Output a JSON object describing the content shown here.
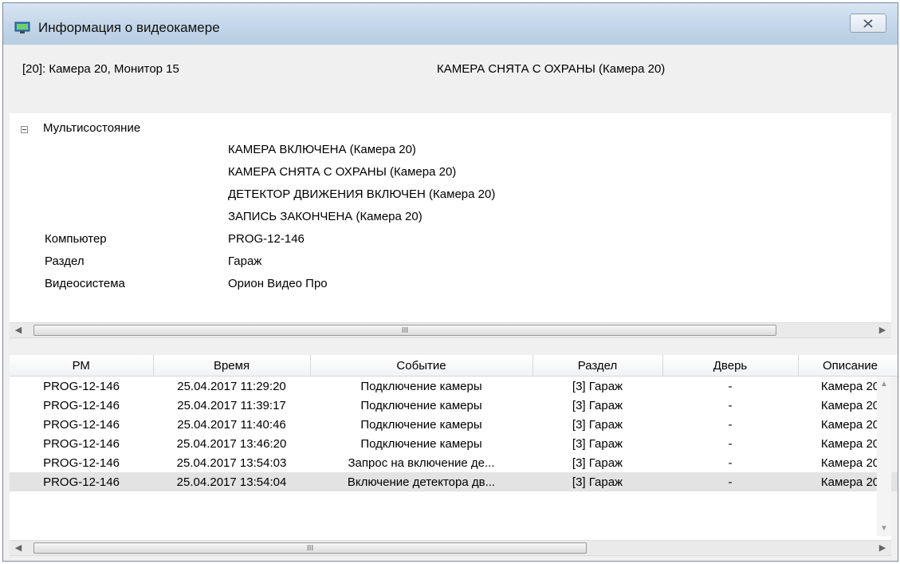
{
  "window": {
    "title": "Информация о видеокамере"
  },
  "info": {
    "camera": "[20]: Камера 20, Монитор 15",
    "state": "КАМЕРА СНЯТА С ОХРАНЫ (Камера 20)"
  },
  "props": {
    "group_label": "Мультисостояние",
    "multistate": [
      "КАМЕРА ВКЛЮЧЕНА (Камера 20)",
      "КАМЕРА СНЯТА С ОХРАНЫ (Камера 20)",
      "ДЕТЕКТОР ДВИЖЕНИЯ ВКЛЮЧЕН (Камера 20)",
      "ЗАПИСЬ ЗАКОНЧЕНА (Камера 20)"
    ],
    "rows": [
      {
        "name": "Компьютер",
        "value": "PROG-12-146"
      },
      {
        "name": "Раздел",
        "value": "Гараж"
      },
      {
        "name": "Видеосистема",
        "value": "Орион Видео Про"
      }
    ]
  },
  "scroll_glyph": "III",
  "events": {
    "columns": [
      "РМ",
      "Время",
      "Событие",
      "Раздел",
      "Дверь",
      "Описание"
    ],
    "rows": [
      [
        "PROG-12-146",
        "25.04.2017 11:29:20",
        "Подключение камеры",
        "[3] Гараж",
        "-",
        "Камера 20"
      ],
      [
        "PROG-12-146",
        "25.04.2017 11:39:17",
        "Подключение камеры",
        "[3] Гараж",
        "-",
        "Камера 20"
      ],
      [
        "PROG-12-146",
        "25.04.2017 11:40:46",
        "Подключение камеры",
        "[3] Гараж",
        "-",
        "Камера 20"
      ],
      [
        "PROG-12-146",
        "25.04.2017 13:46:20",
        "Подключение камеры",
        "[3] Гараж",
        "-",
        "Камера 20"
      ],
      [
        "PROG-12-146",
        "25.04.2017 13:54:03",
        "Запрос на включение де...",
        "[3] Гараж",
        "-",
        "Камера 20"
      ],
      [
        "PROG-12-146",
        "25.04.2017 13:54:04",
        "Включение детектора дв...",
        "[3] Гараж",
        "-",
        "Камера 20"
      ]
    ],
    "selected_row": 5
  }
}
